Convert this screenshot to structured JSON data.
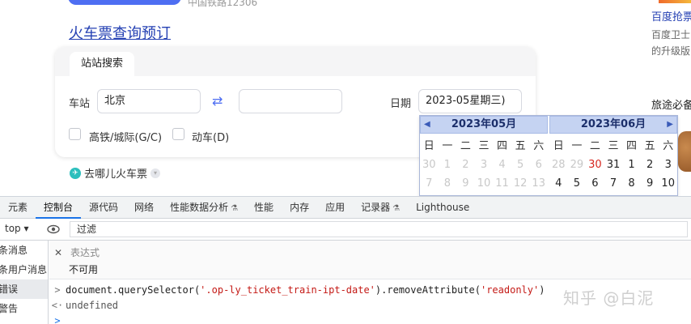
{
  "top": {
    "meta": "中国铁路12306",
    "title": "火车票查询预订",
    "card": {
      "tab": "站站搜索",
      "station_label": "车站",
      "from_value": "北京",
      "to_value": "",
      "date_label": "日期",
      "date_value": "2023-05星期三)",
      "opt_highspeed": "高铁/城际(G/C)",
      "opt_emu": "动车(D)"
    },
    "footer_link": "去哪儿火车票"
  },
  "sidebar": {
    "title": "百度抢票",
    "line1": "百度卫士",
    "line2": "的升级版",
    "heading": "旅途必备"
  },
  "calendar": {
    "months": [
      {
        "title": "2023年05月",
        "weekdays": [
          "日",
          "一",
          "二",
          "三",
          "四",
          "五",
          "六"
        ],
        "row1": [
          "30",
          "1",
          "2",
          "3",
          "4",
          "5",
          "6"
        ],
        "row2": [
          "7",
          "8",
          "9",
          "10",
          "11",
          "12",
          "13"
        ]
      },
      {
        "title": "2023年06月",
        "weekdays": [
          "日",
          "一",
          "二",
          "三",
          "四",
          "五",
          "六"
        ],
        "row1": [
          "28",
          "29",
          "30",
          "31",
          "1",
          "2",
          "3"
        ],
        "row2": [
          "4",
          "5",
          "6",
          "7",
          "8",
          "9",
          "10"
        ]
      }
    ]
  },
  "devtools": {
    "tabs": [
      "元素",
      "控制台",
      "源代码",
      "网络",
      "性能数据分析",
      "性能",
      "内存",
      "应用",
      "记录器",
      "Lighthouse"
    ],
    "active_tab": "控制台",
    "context": "top ▾",
    "filter_placeholder": "过滤",
    "sidebar": [
      "条消息",
      "条用户消息",
      "错误",
      "警告"
    ],
    "expression_placeholder": "表达式",
    "expression_value": "不可用",
    "console": {
      "cmd_prefix": "document.querySelector(",
      "cmd_arg": "'.op-ly_ticket_train-ipt-date'",
      "cmd_mid": ").removeAttribute(",
      "cmd_arg2": "'readonly'",
      "cmd_suffix": ")",
      "result": "undefined"
    }
  },
  "watermark": "知乎 @白泥",
  "colors": {
    "link": "#2440b3",
    "accent": "#4e6ef2",
    "devtools_active": "#1a73e8",
    "string": "#c41a16"
  }
}
